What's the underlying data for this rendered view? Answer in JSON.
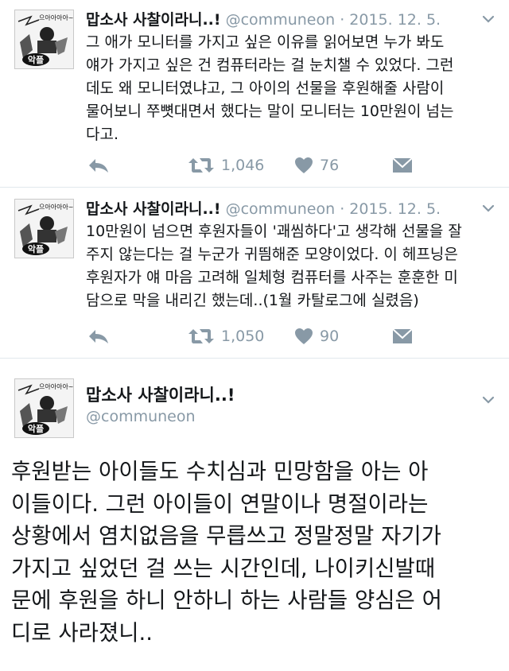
{
  "tweets": [
    {
      "name": "맙소사 사찰이라니..!",
      "handle": "@communeon",
      "date": "2015. 12. 5.",
      "separator": "·",
      "avatar_text": "으아아아아~!!!!",
      "avatar_badge": "악플",
      "body_lines": [
        "그 애가 모니터를 가지고 싶은 이유를 읽어보면 누가 봐도",
        "얘가 가지고 싶은 건 컴퓨터라는 걸 눈치챌 수 있었다. 그런",
        "데도 왜 모니터였냐고, 그 아이의 선물을 후원해줄 사람이",
        "물어보니 쭈뼛대면서 했다는 말이 모니터는 10만원이 넘는",
        "다고."
      ],
      "retweets": "1,046",
      "likes": "76"
    },
    {
      "name": "맙소사 사찰이라니..!",
      "handle": "@communeon",
      "date": "2015. 12. 5.",
      "separator": "·",
      "avatar_text": "으아아아아~!!!!",
      "avatar_badge": "악플",
      "body_lines": [
        "10만원이 넘으면 후원자들이 '괘씸하다'고 생각해 선물을 잘",
        "주지 않는다는 걸 누군가 귀띔해준 모양이었다. 이 헤프닝은",
        "후원자가 얘 마음 고려해 일체형 컴퓨터를 사주는 훈훈한 미",
        "담으로 막을 내리긴 했는데..(1월 카탈로그에 실렸음)"
      ],
      "retweets": "1,050",
      "likes": "90"
    },
    {
      "name": "맙소사 사찰이라니..!",
      "handle": "@communeon",
      "avatar_text": "으아아아아~!!!!",
      "avatar_badge": "악플",
      "body_lines": [
        "후원받는 아이들도 수치심과 민망함을 아는 아",
        "이들이다. 그런 아이들이 연말이나 명절이라는",
        "상황에서 염치없음을 무릅쓰고 정말정말 자기가",
        "가지고 싶었던 걸 쓰는 시간인데, 나이키신발때",
        "문에 후원을 하니 안하니 하는 사람들 양심은 어",
        "디로 사라졌니.."
      ]
    }
  ],
  "icons": {
    "reply": "reply-icon",
    "retweet": "retweet-icon",
    "like": "heart-icon",
    "dm": "envelope-icon",
    "more": "chevron-down-icon"
  },
  "colors": {
    "text": "#14171a",
    "meta": "#8899a6",
    "icon": "#8899a6",
    "divider": "#e1e8ed"
  }
}
